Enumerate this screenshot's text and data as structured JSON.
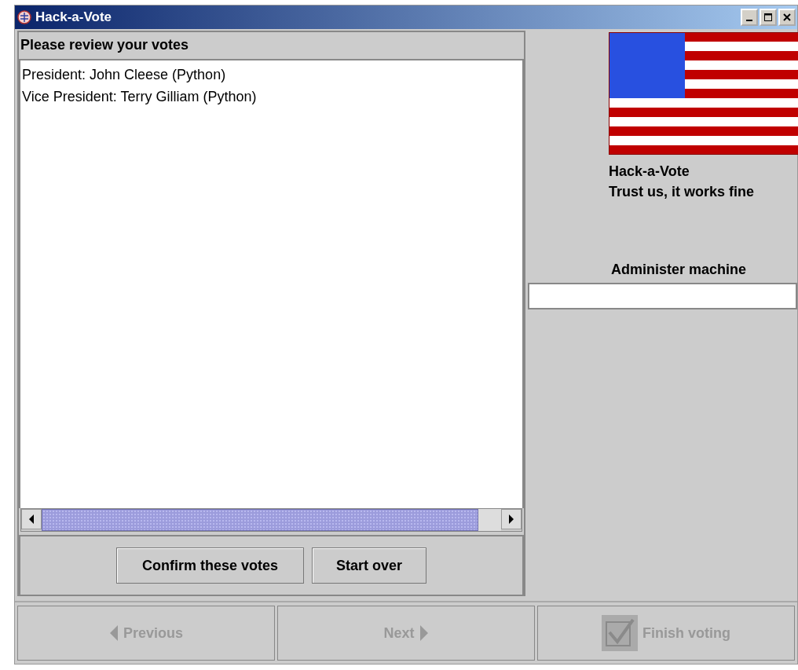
{
  "window": {
    "title": "Hack-a-Vote"
  },
  "review": {
    "heading": "Please review your votes",
    "votes": [
      "President: John Cleese (Python)",
      "Vice President: Terry Gilliam (Python)"
    ],
    "buttons": [
      "Confirm these votes",
      "Start over"
    ]
  },
  "side": {
    "lines": [
      "Hack-a-Vote",
      "Trust us, it works fine"
    ],
    "admin_label": "Administer machine"
  },
  "nav": [
    {
      "kind": "previous",
      "label": "Previous",
      "disabled": true
    },
    {
      "kind": "next",
      "label": "Next",
      "disabled": true
    },
    {
      "kind": "finish",
      "label": "Finish voting",
      "disabled": true
    }
  ]
}
